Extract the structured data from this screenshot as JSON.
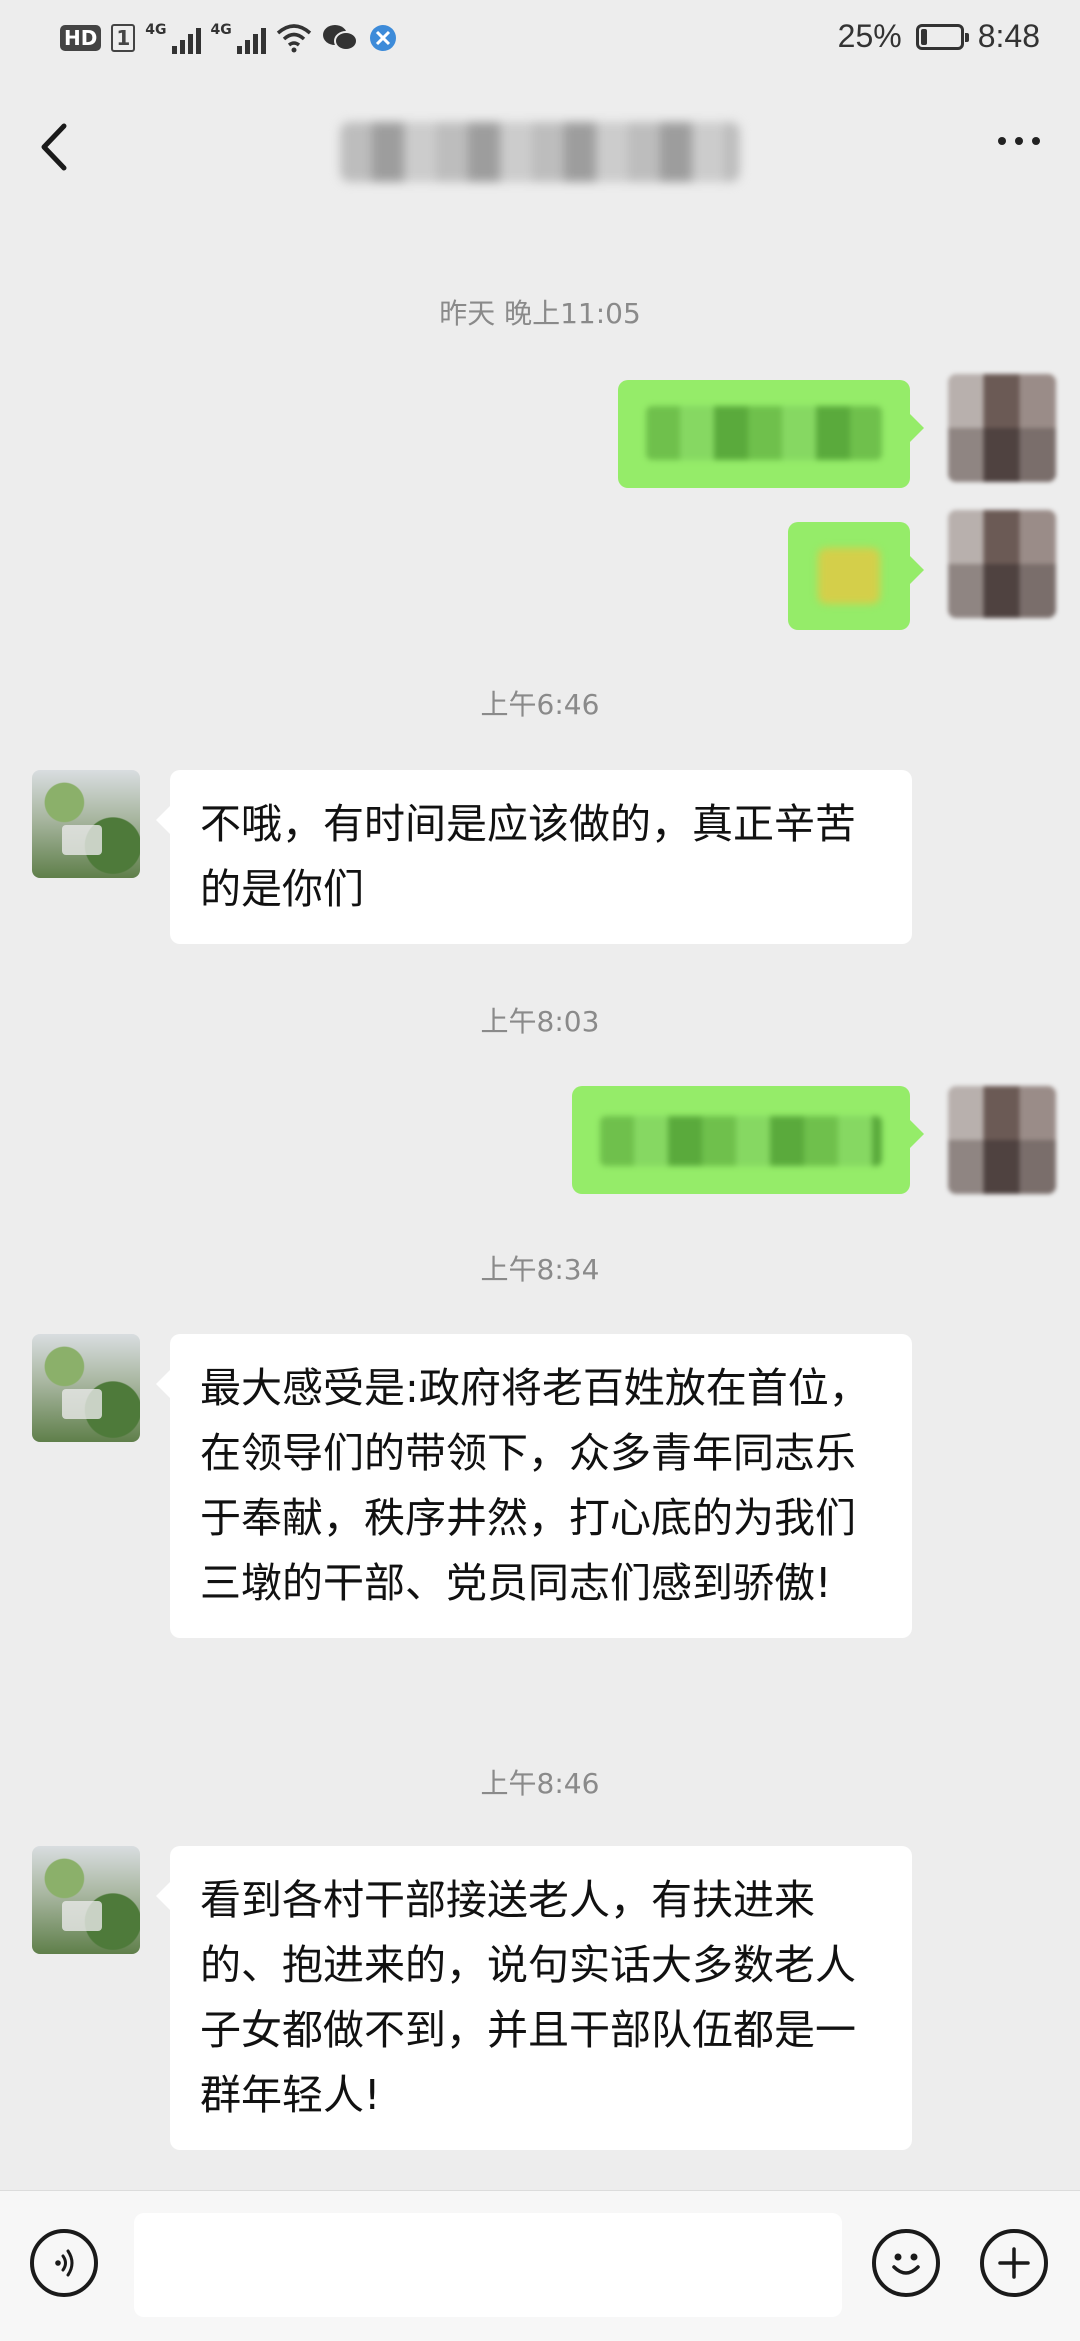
{
  "status_bar": {
    "badge": "HD",
    "sim_slot": "1",
    "net1": "4G",
    "net2": "4G",
    "battery_percent": "25%",
    "battery_level": 0.25,
    "time": "8:48",
    "icons": [
      "wifi-icon",
      "wechat-icon",
      "browser-icon",
      "leaf-battery-icon"
    ]
  },
  "navbar": {
    "back_icon": "chevron-left-icon",
    "more_icon": "more-dots-icon"
  },
  "messages": {
    "ts1": "昨天 晚上11:05",
    "ts2": "上午6:46",
    "peer1": "不哦，有时间是应该做的，真正辛苦的是你们",
    "ts3": "上午8:03",
    "ts4": "上午8:34",
    "peer2": "最大感受是:政府将老百姓放在首位，在领导们的带领下，众多青年同志乐于奉献，秩序井然，打心底的为我们三墩的干部、党员同志们感到骄傲!",
    "ts5": "上午8:46",
    "peer3": "看到各村干部接送老人，有扶进来的、抱进来的，说句实话大多数老人子女都做不到，并且干部队伍都是一群年轻人!"
  },
  "colors": {
    "background": "#ededed",
    "self_bubble": "#95ec69",
    "peer_bubble": "#ffffff",
    "timestamp": "#8a8a8a"
  },
  "inputbar": {
    "voice_icon": "voice-icon",
    "emoji_icon": "emoji-icon",
    "plus_icon": "plus-icon"
  }
}
